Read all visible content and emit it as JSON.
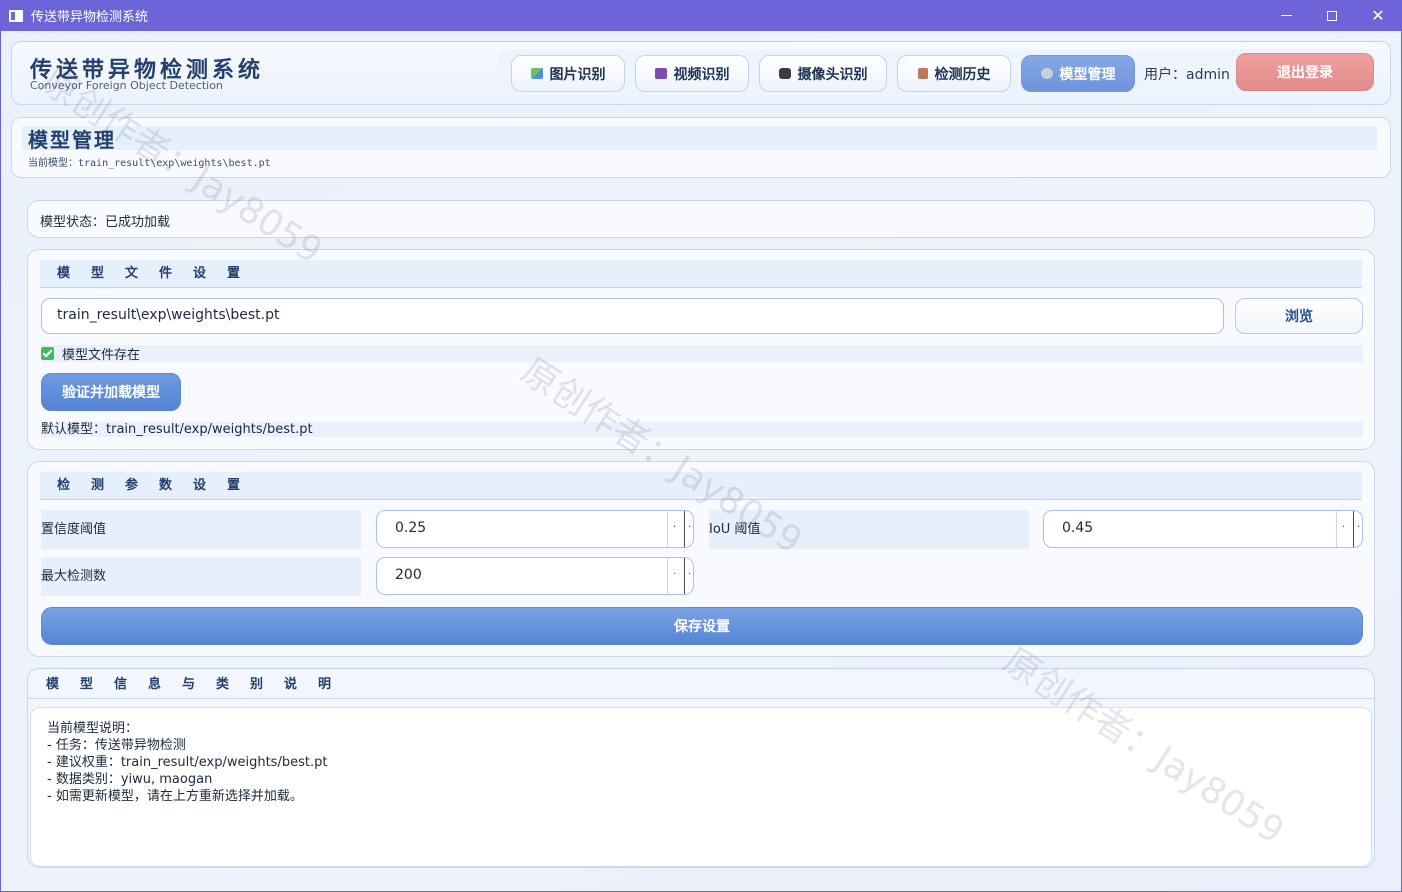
{
  "window": {
    "title": "传送带异物检测系统"
  },
  "header": {
    "title": "传送带异物检测系统",
    "subtitle": "Conveyor Foreign Object Detection",
    "nav": [
      {
        "label": "图片识别",
        "icon": "image-icon"
      },
      {
        "label": "视频识别",
        "icon": "video-icon"
      },
      {
        "label": "摄像头识别",
        "icon": "camera-icon"
      },
      {
        "label": "检测历史",
        "icon": "history-icon"
      },
      {
        "label": "模型管理",
        "icon": "gear-icon",
        "active": true
      }
    ],
    "user": "用户：admin",
    "logout": "退出登录"
  },
  "page": {
    "title": "模型管理",
    "current_model": "当前模型：train_result\\exp\\weights\\best.pt"
  },
  "status": {
    "text": "模型状态：已成功加载"
  },
  "model_file": {
    "heading": "模型文件设置",
    "path": "train_result\\exp\\weights\\best.pt",
    "browse": "浏览",
    "exists_label": "模型文件存在",
    "exists_checked": true,
    "load_button": "验证并加载模型",
    "default_model": "默认模型：train_result/exp/weights/best.pt"
  },
  "params": {
    "heading": "检测参数设置",
    "conf_label": "置信度阈值",
    "conf_value": "0.25",
    "iou_label": "IoU 阈值",
    "iou_value": "0.45",
    "max_label": "最大检测数",
    "max_value": "200",
    "save_button": "保存设置"
  },
  "info": {
    "heading": "模型信息与类别说明",
    "text": "当前模型说明：\n- 任务：传送带异物检测\n- 建议权重：train_result/exp/weights/best.pt\n- 数据类别：yiwu, maogan\n- 如需更新模型，请在上方重新选择并加载。"
  },
  "watermark": "原创作者：Jay8059",
  "colors": {
    "titlebar": "#6c64d8",
    "accent": "#5486d4",
    "logout": "#e48a8a",
    "check": "#47b85d"
  }
}
